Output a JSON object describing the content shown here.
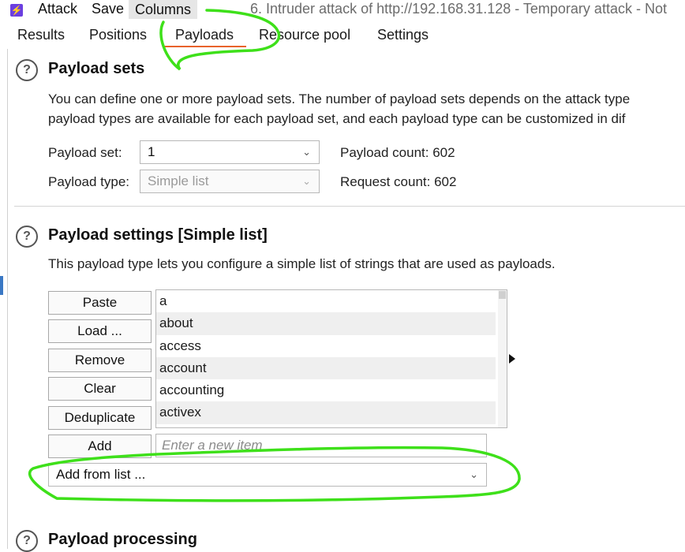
{
  "menubar": {
    "app_icon": "burp-lightning-icon",
    "items": [
      "Attack",
      "Save",
      "Columns"
    ],
    "window_title": "6. Intruder attack of http://192.168.31.128 - Temporary attack - Not"
  },
  "tabs": [
    "Results",
    "Positions",
    "Payloads",
    "Resource pool",
    "Settings"
  ],
  "active_tab": "Payloads",
  "payload_sets": {
    "help_icon": "?",
    "title": "Payload sets",
    "desc_line1": "You can define one or more payload sets. The number of payload sets depends on the attack type",
    "desc_line2": "payload types are available for each payload set, and each payload type can be customized in dif",
    "set_label": "Payload set:",
    "set_value": "1",
    "type_label": "Payload type:",
    "type_value": "Simple list",
    "payload_count": "Payload count: 602",
    "request_count": "Request count: 602"
  },
  "payload_settings": {
    "help_icon": "?",
    "title": "Payload settings [Simple list]",
    "desc": "This payload type lets you configure a simple list of strings that are used as payloads.",
    "buttons": {
      "paste": "Paste",
      "load": "Load ...",
      "remove": "Remove",
      "clear": "Clear",
      "deduplicate": "Deduplicate",
      "add": "Add"
    },
    "items": [
      "a",
      "about",
      "access",
      "account",
      "accounting",
      "activex"
    ],
    "new_item_placeholder": "Enter a new item",
    "add_from_list": "Add from list ..."
  },
  "payload_processing": {
    "help_icon": "?",
    "title": "Payload processing"
  },
  "colors": {
    "accent": "#e8622b",
    "annotation": "#3ee01a"
  }
}
